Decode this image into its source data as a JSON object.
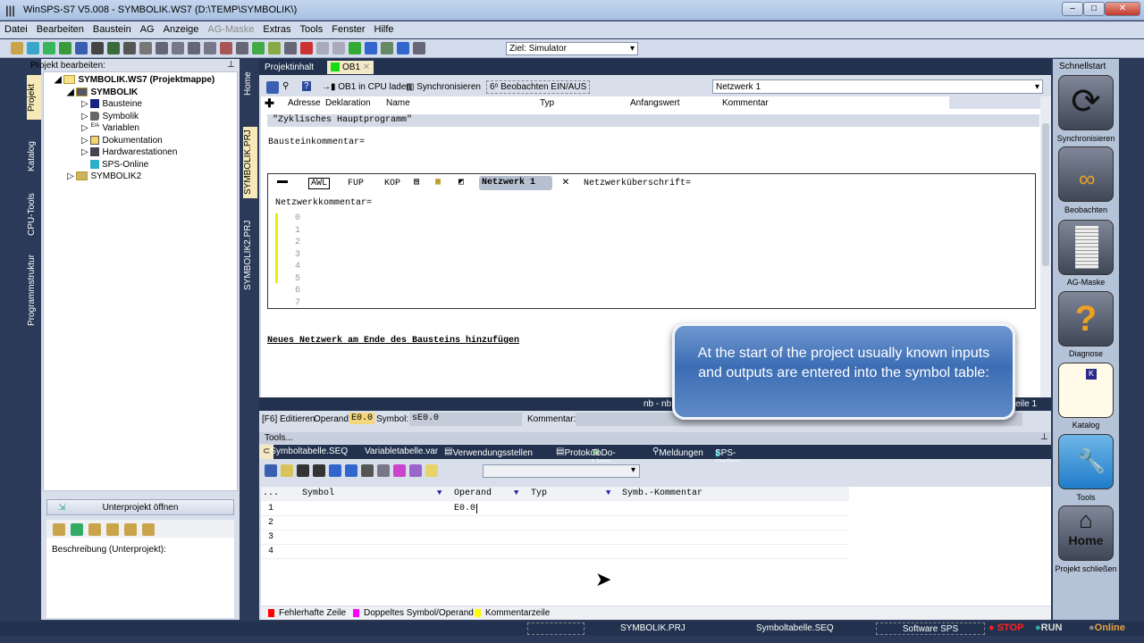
{
  "window": {
    "title": "WinSPS-S7 V5.008 - SYMBOLIK.WS7 (D:\\TEMP\\SYMBOLIK\\)"
  },
  "menu": [
    "Datei",
    "Bearbeiten",
    "Baustein",
    "AG",
    "Anzeige",
    "AG-Maske",
    "Extras",
    "Tools",
    "Fenster",
    "Hilfe"
  ],
  "toolbar": {
    "target": "Ziel: Simulator"
  },
  "left": {
    "header": "Projekt bearbeiten:",
    "vtabs": [
      "Projekt",
      "Katalog",
      "CPU-Tools",
      "Programmstruktur"
    ],
    "tree": {
      "root": "SYMBOLIK.WS7 (Projektmappe)",
      "project": "SYMBOLIK",
      "children": [
        "Bausteine",
        "Symbolik",
        "Variablen",
        "Dokumentation",
        "Hardwarestationen",
        "SPS-Online"
      ],
      "project2": "SYMBOLIK2"
    },
    "subproject_button": "Unterprojekt öffnen",
    "description_label": "Beschreibung (Unterprojekt):"
  },
  "center_vtabs": [
    "Home",
    "SYMBOLIK.PRJ",
    "SYMBOLIK2.PRJ"
  ],
  "tabs": [
    "Projektinhalt",
    "OB1"
  ],
  "editor_toolbar": {
    "load": "OB1 in CPU laden",
    "sync": "Synchronisieren",
    "watch": "Beobachten EIN/AUS",
    "network_select": "Netzwerk 1"
  },
  "columns": [
    "Adresse",
    "Deklaration",
    "Name",
    "Typ",
    "Anfangswert",
    "Kommentar"
  ],
  "block_title": "\"Zyklisches Hauptprogramm\"",
  "block_comment": "Bausteinkommentar=",
  "network": {
    "modes": [
      "AWL",
      "FUP",
      "KOP"
    ],
    "name": "Netzwerk 1",
    "heading": "Netzwerküberschrift=",
    "comment": "Netzwerkkommentar=",
    "lines": [
      "0",
      "1",
      "2",
      "3",
      "4",
      "5",
      "6",
      "7"
    ]
  },
  "add_network": "Neues Netzwerk am Ende des Bausteins hinzufügen",
  "darkbar": {
    "nb": "nb - nb",
    "zeile": "Zeile 1"
  },
  "editrow": {
    "f6": "[F6] Editieren",
    "operand_label": "Operand:",
    "operand": "E0.0",
    "symbol_label": "Symbol:",
    "symbol": "sE0.0",
    "comment_label": "Kommentar:"
  },
  "tools_label": "Tools...",
  "tool_tabs": [
    "Symboltabelle.SEQ",
    "Variabletabelle.var",
    "Verwendungsstellen",
    "Protokoll",
    "ToDo-Liste",
    "Meldungen",
    "SPS-Online"
  ],
  "symtable": {
    "headers": [
      "...",
      "Symbol",
      "Operand",
      "Typ",
      "Symb.-Kommentar"
    ],
    "rows": [
      {
        "n": "1",
        "operand": "E0.0"
      },
      {
        "n": "2",
        "operand": ""
      },
      {
        "n": "3",
        "operand": ""
      },
      {
        "n": "4",
        "operand": ""
      }
    ]
  },
  "legend": [
    {
      "label": "Fehlerhafte Zeile",
      "color": "#ff0000"
    },
    {
      "label": "Doppeltes Symbol/Operand",
      "color": "#ff00ff"
    },
    {
      "label": "Kommentarzeile",
      "color": "#ffff00"
    }
  ],
  "quickstart": {
    "title": "Schnellstart",
    "items": [
      "Synchronisieren",
      "Beobachten",
      "AG-Maske",
      "Diagnose",
      "Katalog",
      "Tools",
      "Projekt schließen"
    ],
    "home_label": "Home"
  },
  "statusbar": {
    "project": "SYMBOLIK.PRJ",
    "file": "Symboltabelle.SEQ",
    "mode": "Software SPS",
    "stop": "STOP",
    "run": "RUN",
    "online": "Online"
  },
  "callout": "At the start of the project usually known inputs and outputs are entered into the symbol table:"
}
